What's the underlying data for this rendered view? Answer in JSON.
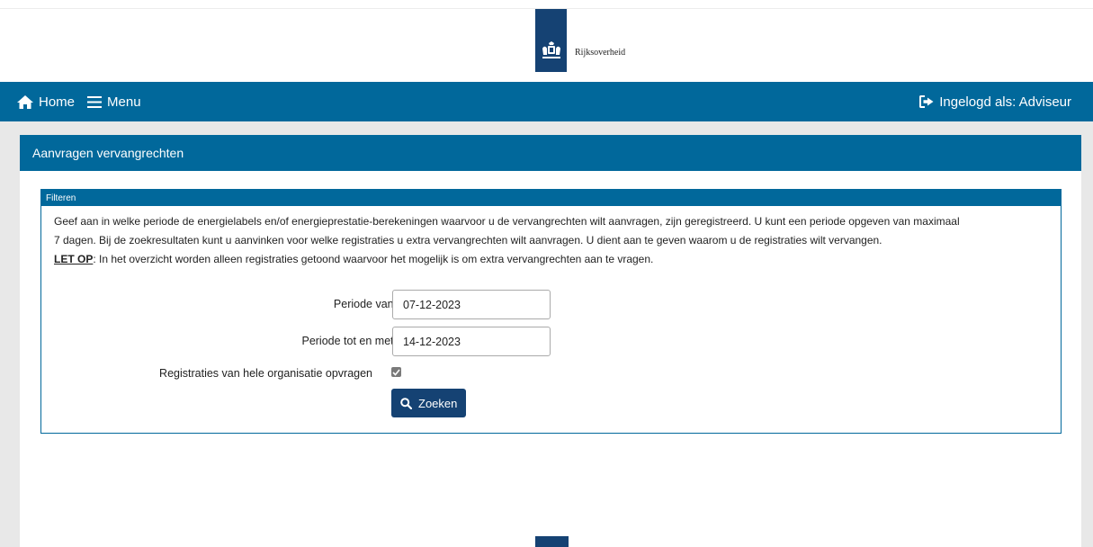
{
  "header": {
    "logo_text": "Rijksoverheid"
  },
  "nav": {
    "home_label": "Home",
    "menu_label": "Menu",
    "login_label": "Ingelogd als: Adviseur"
  },
  "page": {
    "title": "Aanvragen vervangrechten"
  },
  "filter": {
    "title": "Filteren",
    "intro_line1": "Geef aan in welke periode de energielabels en/of energieprestatie-berekeningen waarvoor u de vervangrechten wilt aanvragen, zijn geregistreerd. U kunt een periode opgeven van maximaal",
    "intro_line2": "7 dagen. Bij de zoekresultaten kunt u aanvinken voor welke registraties u extra vervangrechten wilt aanvragen. U dient aan te geven waarom u de registraties wilt vervangen.",
    "letop_label": "LET OP",
    "letop_text": ": In het overzicht worden alleen registraties getoond waarvoor het mogelijk is om extra vervangrechten aan te vragen.",
    "periode_van_label": "Periode van",
    "periode_van_value": "07-12-2023",
    "periode_tot_label": "Periode tot en met",
    "periode_tot_value": "14-12-2023",
    "required_mark": "*",
    "organisatie_label": "Registraties van hele organisatie opvragen",
    "organisatie_checked": true,
    "search_button": "Zoeken"
  },
  "colors": {
    "nav_blue": "#01689b",
    "dark_blue": "#154273",
    "required_red": "#d52b1e"
  }
}
